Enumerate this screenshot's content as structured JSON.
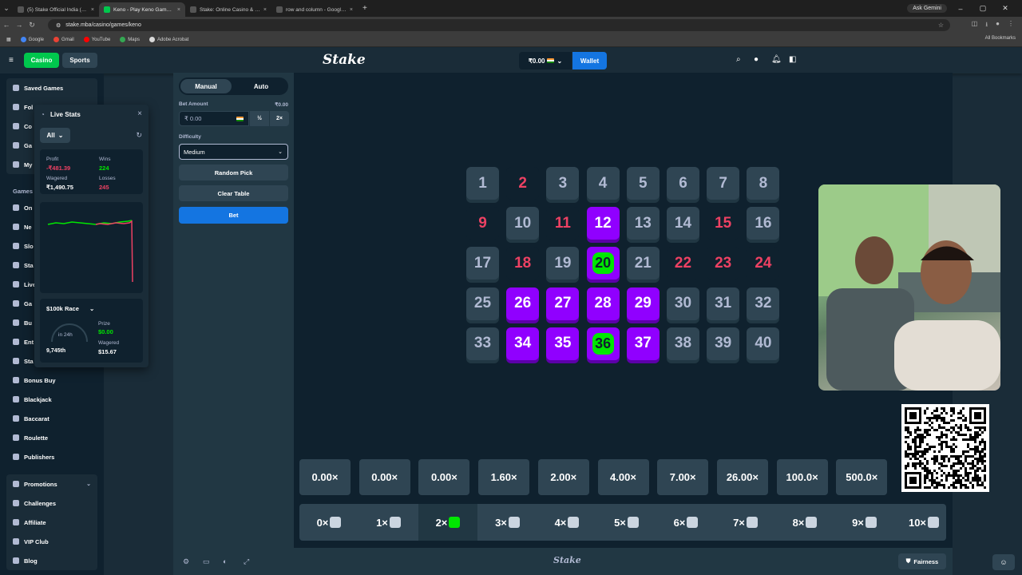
{
  "browser": {
    "tabs": [
      {
        "title": "(5) Stake Official India (@Stake"
      },
      {
        "title": "Keno - Play Keno Game Online"
      },
      {
        "title": "Stake: Online Casino & Sports"
      },
      {
        "title": "row and column - Google Search"
      }
    ],
    "gemini": "Ask Gemini",
    "url": "stake.mba/casino/games/keno",
    "bookmarks": [
      "Google",
      "Gmail",
      "YouTube",
      "Maps",
      "Adobe Acrobat"
    ],
    "all_bookmarks": "All Bookmarks"
  },
  "header": {
    "casino": "Casino",
    "sports": "Sports",
    "logo": "Stake",
    "balance": "₹0.00",
    "wallet": "Wallet"
  },
  "sidebar": {
    "top": [
      "Saved Games",
      "Fol",
      "Co",
      "Ga",
      "My"
    ],
    "games_title": "Games",
    "games": [
      "On",
      "Ne",
      "Slo",
      "Sta",
      "Live",
      "Ga",
      "Bu",
      "Ent",
      "Sta",
      "Bonus Buy",
      "Blackjack",
      "Baccarat",
      "Roulette",
      "Publishers"
    ],
    "bottom": [
      "Promotions",
      "Challenges",
      "Affiliate",
      "VIP Club",
      "Blog"
    ]
  },
  "live_stats": {
    "title": "Live Stats",
    "filter": "All",
    "profit_label": "Profit",
    "profit": "-₹481.39",
    "wins_label": "Wins",
    "wins": "224",
    "wagered_label": "Wagered",
    "wagered": "₹1,490.75",
    "losses_label": "Losses",
    "losses": "245",
    "race": "$100k Race",
    "race_time": "in 24h",
    "prize_label": "Prize",
    "prize": "$0.00",
    "race_wagered_label": "Wagered",
    "race_wagered": "$15.67",
    "rank": "9,745th"
  },
  "bet_panel": {
    "manual": "Manual",
    "auto": "Auto",
    "bet_amount_label": "Bet Amount",
    "bet_amount_usd": "₹0.00",
    "bet_amount_value": "₹ 0.00",
    "half": "½",
    "double": "2×",
    "difficulty_label": "Difficulty",
    "difficulty": "Medium",
    "random_pick": "Random Pick",
    "clear_table": "Clear Table",
    "bet": "Bet"
  },
  "keno": {
    "tiles": [
      {
        "n": "1",
        "state": "normal"
      },
      {
        "n": "2",
        "state": "miss"
      },
      {
        "n": "3",
        "state": "normal"
      },
      {
        "n": "4",
        "state": "normal"
      },
      {
        "n": "5",
        "state": "normal"
      },
      {
        "n": "6",
        "state": "normal"
      },
      {
        "n": "7",
        "state": "normal"
      },
      {
        "n": "8",
        "state": "normal"
      },
      {
        "n": "9",
        "state": "miss"
      },
      {
        "n": "10",
        "state": "normal"
      },
      {
        "n": "11",
        "state": "miss"
      },
      {
        "n": "12",
        "state": "picked"
      },
      {
        "n": "13",
        "state": "normal"
      },
      {
        "n": "14",
        "state": "normal"
      },
      {
        "n": "15",
        "state": "miss"
      },
      {
        "n": "16",
        "state": "normal"
      },
      {
        "n": "17",
        "state": "normal"
      },
      {
        "n": "18",
        "state": "miss"
      },
      {
        "n": "19",
        "state": "normal"
      },
      {
        "n": "20",
        "state": "hit"
      },
      {
        "n": "21",
        "state": "normal"
      },
      {
        "n": "22",
        "state": "miss"
      },
      {
        "n": "23",
        "state": "miss"
      },
      {
        "n": "24",
        "state": "miss"
      },
      {
        "n": "25",
        "state": "normal"
      },
      {
        "n": "26",
        "state": "picked"
      },
      {
        "n": "27",
        "state": "picked"
      },
      {
        "n": "28",
        "state": "picked"
      },
      {
        "n": "29",
        "state": "picked"
      },
      {
        "n": "30",
        "state": "normal"
      },
      {
        "n": "31",
        "state": "normal"
      },
      {
        "n": "32",
        "state": "normal"
      },
      {
        "n": "33",
        "state": "normal"
      },
      {
        "n": "34",
        "state": "picked"
      },
      {
        "n": "35",
        "state": "picked"
      },
      {
        "n": "36",
        "state": "hit"
      },
      {
        "n": "37",
        "state": "picked"
      },
      {
        "n": "38",
        "state": "normal"
      },
      {
        "n": "39",
        "state": "normal"
      },
      {
        "n": "40",
        "state": "normal"
      }
    ],
    "payouts": [
      "0.00×",
      "0.00×",
      "0.00×",
      "1.60×",
      "2.00×",
      "4.00×",
      "7.00×",
      "26.00×",
      "100.0×",
      "500.0×"
    ],
    "hits": [
      "0×",
      "1×",
      "2×",
      "3×",
      "4×",
      "5×",
      "6×",
      "7×",
      "8×",
      "9×",
      "10×"
    ],
    "active_hits": "2×"
  },
  "footer": {
    "logo": "Stake",
    "fairness": "Fairness"
  },
  "colors": {
    "bg": "#1a2c38",
    "panel": "#213743",
    "dark": "#0f212e",
    "accent_green": "#00e701",
    "accent_purple": "#9000ff",
    "accent_blue": "#1475e1",
    "negative": "#ed4163"
  }
}
